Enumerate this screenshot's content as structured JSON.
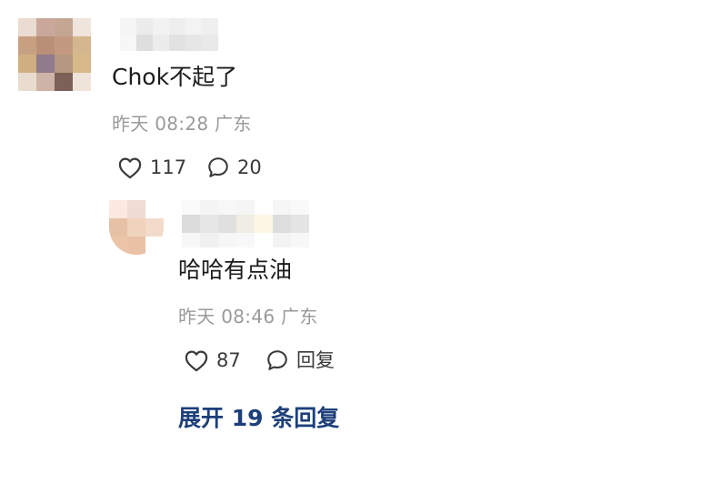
{
  "comment": {
    "text": "Chok不起了",
    "time": "昨天 08:28 广东",
    "likes": "117",
    "replies": "20"
  },
  "reply": {
    "text": "哈哈有点油",
    "time": "昨天 08:46 广东",
    "likes": "87",
    "reply_label": "回复"
  },
  "expand_label": "展开 19 条回复",
  "colors": {
    "link": "#1d3f7a",
    "meta": "#9a9a9a",
    "icon": "#3a3a3a"
  },
  "icons": [
    "heart-icon",
    "comment-bubble-icon"
  ]
}
